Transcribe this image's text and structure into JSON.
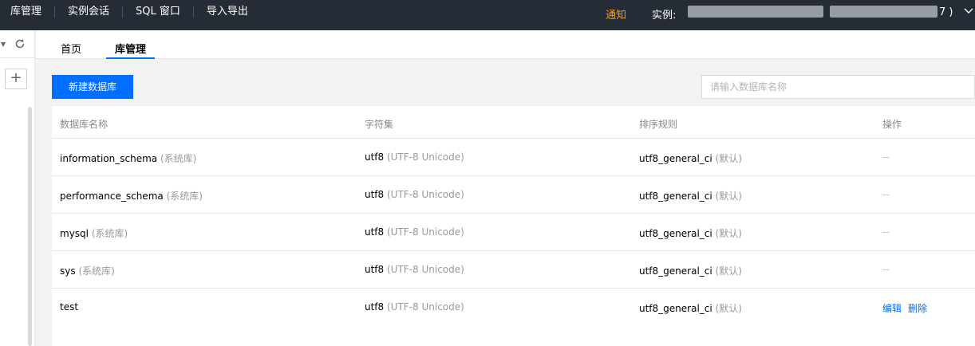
{
  "topnav": {
    "items": [
      "库管理",
      "实例会话",
      "SQL 窗口",
      "导入导出"
    ],
    "notice": "通知",
    "instance_label": "实例:",
    "instance_tail": "7 )"
  },
  "rail": {
    "refresh_icon": "refresh-icon",
    "add_icon": "plus-icon"
  },
  "tabs": [
    "首页",
    "库管理"
  ],
  "toolbar": {
    "new_button": "新建数据库",
    "search_placeholder": "请输入数据库名称"
  },
  "table": {
    "headers": [
      "数据库名称",
      "字符集",
      "排序规则",
      "操作"
    ],
    "rows": [
      {
        "name": "information_schema",
        "tag": "(系统库)",
        "charset": "utf8",
        "charset_desc": "(UTF-8 Unicode)",
        "collation": "utf8_general_ci",
        "collation_note": "(默认)",
        "op": "--"
      },
      {
        "name": "performance_schema",
        "tag": "(系统库)",
        "charset": "utf8",
        "charset_desc": "(UTF-8 Unicode)",
        "collation": "utf8_general_ci",
        "collation_note": "(默认)",
        "op": "--"
      },
      {
        "name": "mysql",
        "tag": "(系统库)",
        "charset": "utf8",
        "charset_desc": "(UTF-8 Unicode)",
        "collation": "utf8_general_ci",
        "collation_note": "(默认)",
        "op": "--"
      },
      {
        "name": "sys",
        "tag": "(系统库)",
        "charset": "utf8",
        "charset_desc": "(UTF-8 Unicode)",
        "collation": "utf8_general_ci",
        "collation_note": "(默认)",
        "op": "--"
      },
      {
        "name": "test",
        "tag": "",
        "charset": "utf8",
        "charset_desc": "(UTF-8 Unicode)",
        "collation": "utf8_general_ci",
        "collation_note": "(默认)",
        "op_edit": "编辑",
        "op_delete": "删除"
      }
    ]
  },
  "colors": {
    "topbar": "#262c36",
    "accent": "#006eff",
    "notice": "#ff9d00"
  }
}
